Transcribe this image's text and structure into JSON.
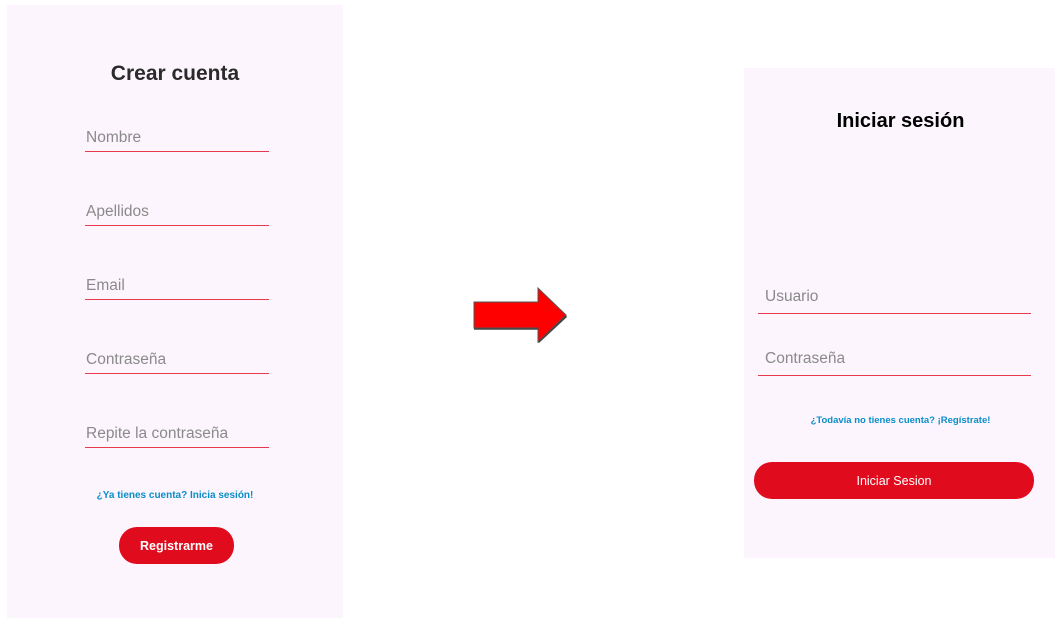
{
  "register": {
    "title": "Crear cuenta",
    "fields": [
      {
        "placeholder": "Nombre"
      },
      {
        "placeholder": "Apellidos"
      },
      {
        "placeholder": "Email"
      },
      {
        "placeholder": "Contraseña"
      },
      {
        "placeholder": "Repite la contraseña"
      }
    ],
    "login_link": "¿Ya tienes cuenta? Inicia sesión!",
    "submit_label": "Registrarme"
  },
  "login": {
    "title": "Iniciar sesión",
    "fields": [
      {
        "placeholder": "Usuario"
      },
      {
        "placeholder": "Contraseña"
      }
    ],
    "register_link": "¿Todavía no tienes cuenta? ¡Regístrate!",
    "submit_label": "Iniciar Sesion"
  },
  "arrow_icon": "right-arrow-icon",
  "colors": {
    "accent": "#e10b1e",
    "field_underline": "#e8394d",
    "link": "#0a8ec7",
    "screen_bg": "#fcf5fd",
    "arrow_fill": "#ff0000"
  }
}
